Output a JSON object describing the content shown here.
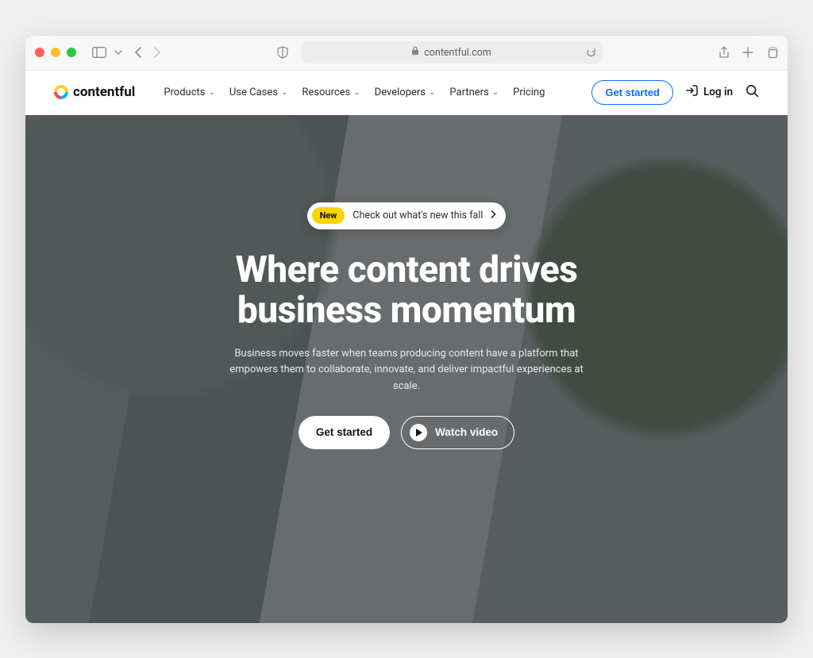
{
  "browser": {
    "url": "contentful.com"
  },
  "nav": {
    "brand": "contentful",
    "items": [
      {
        "label": "Products",
        "dropdown": true
      },
      {
        "label": "Use Cases",
        "dropdown": true
      },
      {
        "label": "Resources",
        "dropdown": true
      },
      {
        "label": "Developers",
        "dropdown": true
      },
      {
        "label": "Partners",
        "dropdown": true
      },
      {
        "label": "Pricing",
        "dropdown": false
      }
    ],
    "cta": "Get started",
    "login": "Log in"
  },
  "hero": {
    "badge": "New",
    "pill_text": "Check out what's new this fall",
    "headline_l1": "Where content drives",
    "headline_l2": "business momentum",
    "sub": "Business moves faster when teams producing content have a platform that empowers them to collaborate, innovate, and deliver impactful experiences at scale.",
    "cta_primary": "Get started",
    "cta_video": "Watch video"
  }
}
